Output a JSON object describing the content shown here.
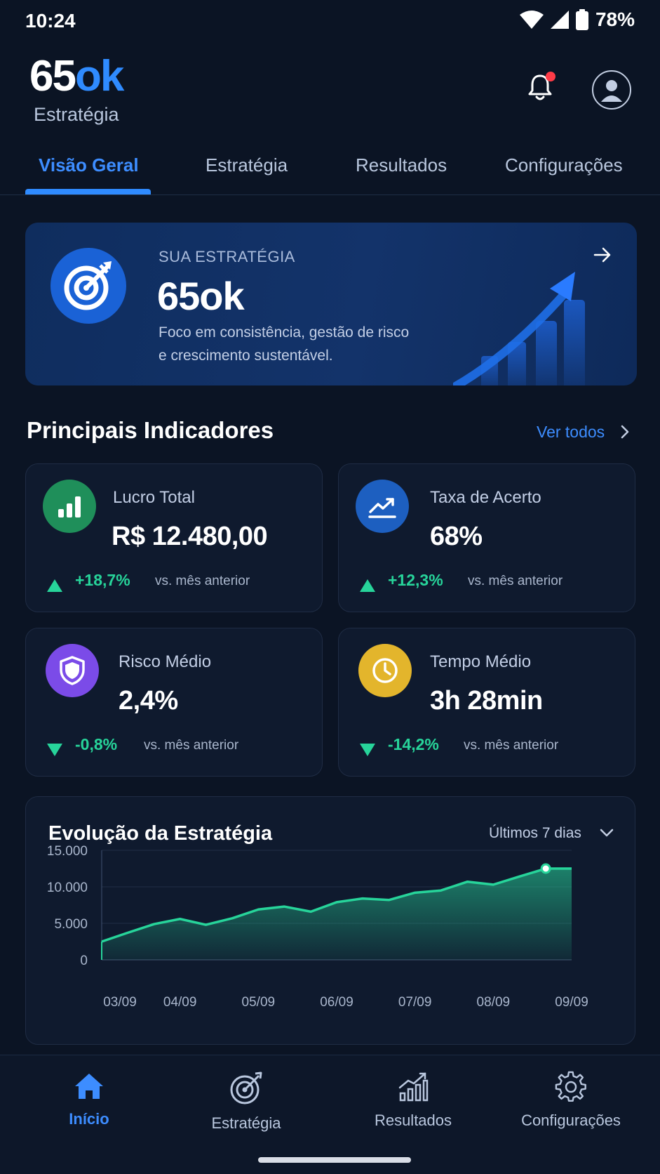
{
  "status_bar": {
    "time": "10:24",
    "battery": "78%"
  },
  "header": {
    "logo_main": "65",
    "logo_accent": "ok",
    "logo_sub": "Estratégia"
  },
  "tabs": [
    {
      "label": "Visão Geral",
      "active": true
    },
    {
      "label": "Estratégia",
      "active": false
    },
    {
      "label": "Resultados",
      "active": false
    },
    {
      "label": "Configurações",
      "active": false
    }
  ],
  "hero": {
    "eyebrow": "SUA ESTRATÉGIA",
    "title": "65ok",
    "desc_line1": "Foco em consistência, gestão de risco",
    "desc_line2": "e crescimento sustentável."
  },
  "indicators": {
    "title": "Principais Indicadores",
    "see_all": "Ver todos",
    "cards": [
      {
        "label": "Lucro Total",
        "value": "R$ 12.480,00",
        "delta": "+18,7%",
        "direction": "up",
        "compare": "vs. mês anterior",
        "icon": "bar-chart-icon",
        "color": "#1f8f5a"
      },
      {
        "label": "Taxa de Acerto",
        "value": "68%",
        "delta": "+12,3%",
        "direction": "up",
        "compare": "vs. mês anterior",
        "icon": "trend-up-icon",
        "color": "#1d5fc0"
      },
      {
        "label": "Risco Médio",
        "value": "2,4%",
        "delta": "-0,8%",
        "direction": "down",
        "compare": "vs. mês anterior",
        "icon": "shield-icon",
        "color": "#7b4be8"
      },
      {
        "label": "Tempo Médio",
        "value": "3h 28min",
        "delta": "-14,2%",
        "direction": "down",
        "compare": "vs. mês anterior",
        "icon": "clock-icon",
        "color": "#e3b52c"
      }
    ]
  },
  "chart_card": {
    "title": "Evolução da Estratégia",
    "range": "Últimos 7 dias"
  },
  "chart_data": {
    "type": "area",
    "categories": [
      "03/09",
      "04/09",
      "05/09",
      "06/09",
      "07/09",
      "08/09",
      "09/09"
    ],
    "y_ticks": [
      "15.000",
      "10.000",
      "5.000",
      "0"
    ],
    "ylim": [
      0,
      15000
    ],
    "series": [
      {
        "x": [
          0,
          0.33,
          0.67,
          1,
          1.33,
          1.67,
          2,
          2.33,
          2.67,
          3,
          3.33,
          3.67,
          4,
          4.33,
          4.67,
          5,
          5.33,
          5.67,
          6,
          6.33,
          6.67
        ],
        "values": [
          2500,
          3700,
          4900,
          5600,
          4800,
          5700,
          6900,
          7300,
          6600,
          7900,
          8400,
          8200,
          9200,
          9500,
          10700,
          10300,
          11400,
          12500,
          12500,
          12500,
          12500
        ],
        "color": "#27d49a"
      }
    ]
  },
  "bottom_nav": [
    {
      "label": "Início",
      "icon": "home-icon",
      "active": true
    },
    {
      "label": "Estratégia",
      "icon": "target-icon",
      "active": false
    },
    {
      "label": "Resultados",
      "icon": "bar-trend-icon",
      "active": false
    },
    {
      "label": "Configurações",
      "icon": "gear-icon",
      "active": false
    }
  ],
  "colors": {
    "accent": "#2f8bff",
    "positive": "#27d49a",
    "background": "#0b1424",
    "card": "#0f1a2e"
  }
}
